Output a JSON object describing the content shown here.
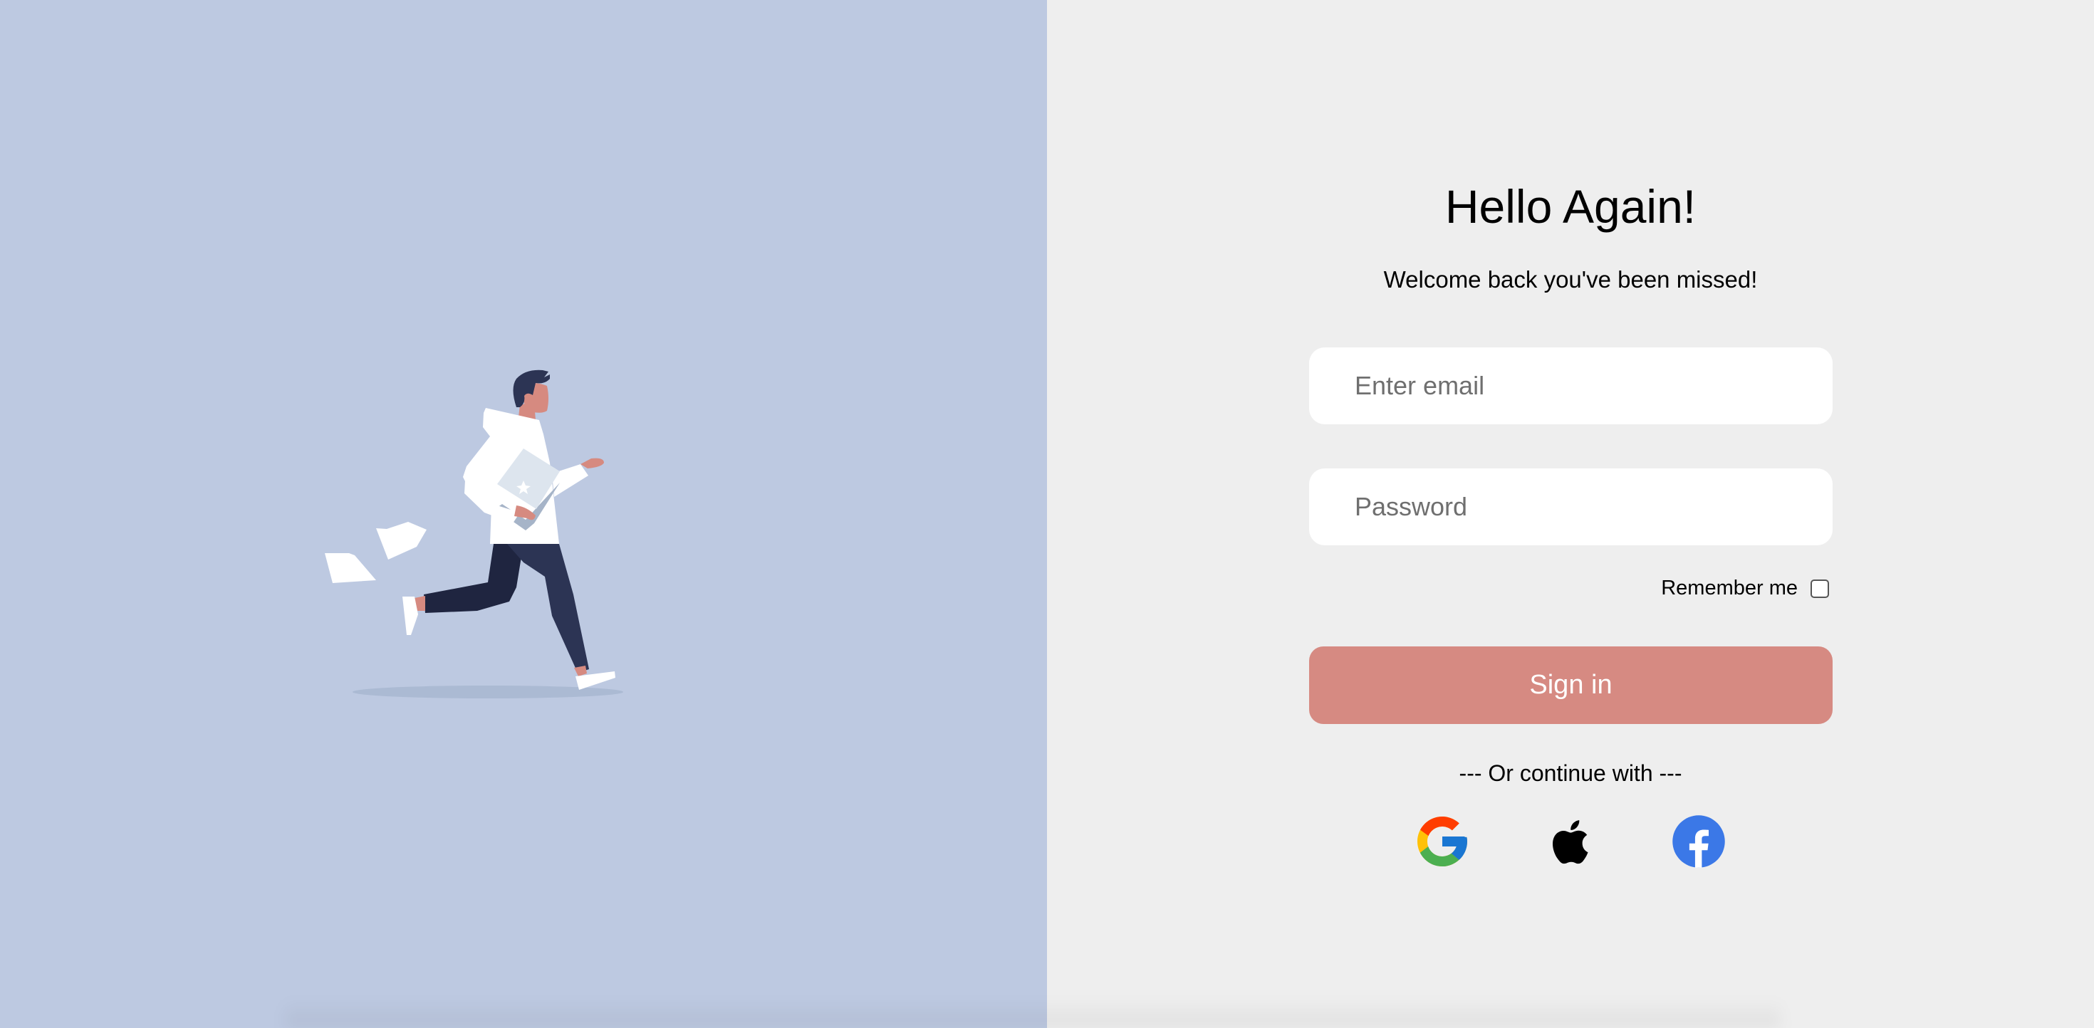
{
  "login": {
    "title": "Hello Again!",
    "subtitle": "Welcome back you've been missed!",
    "email_placeholder": "Enter email",
    "password_placeholder": "Password",
    "remember_label": "Remember me",
    "remember_checked": false,
    "signin_label": "Sign in",
    "divider_text": "--- Or continue with ---",
    "social": [
      "google-icon",
      "apple-icon",
      "facebook-icon"
    ]
  },
  "colors": {
    "left_bg": "#bdc9e1",
    "right_bg": "#eeeeee",
    "button": "#d68a82",
    "facebook": "#3b78e7"
  }
}
